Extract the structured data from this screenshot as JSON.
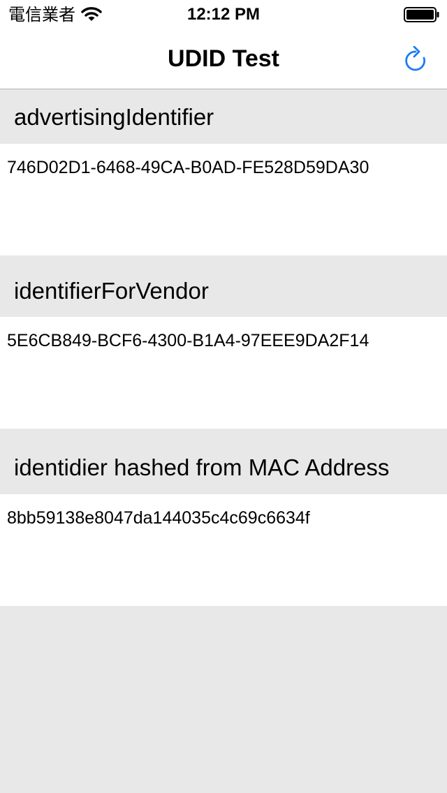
{
  "status_bar": {
    "carrier": "電信業者",
    "time": "12:12 PM",
    "wifi_icon": "wifi-icon",
    "battery_icon": "battery-full-icon"
  },
  "nav": {
    "title": "UDID Test",
    "refresh_icon": "refresh-icon",
    "accent_color": "#1a7cf5"
  },
  "sections": [
    {
      "header": "advertisingIdentifier",
      "value": "746D02D1-6468-49CA-B0AD-FE528D59DA30"
    },
    {
      "header": "identifierForVendor",
      "value": "5E6CB849-BCF6-4300-B1A4-97EEE9DA2F14"
    },
    {
      "header": "identidier hashed from MAC Address",
      "value": "8bb59138e8047da144035c4c69c6634f"
    }
  ]
}
